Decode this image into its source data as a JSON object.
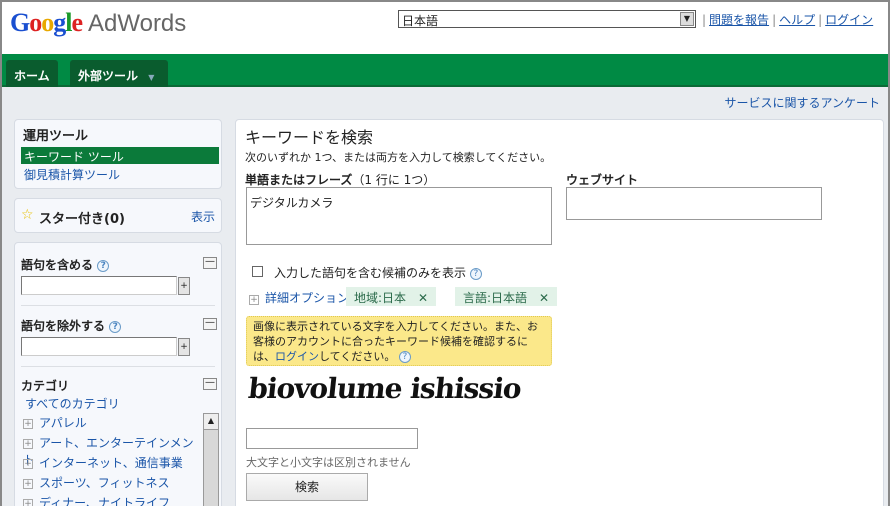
{
  "header": {
    "logo": "Google AdWords",
    "logo_google": "Google",
    "logo_product": "AdWords",
    "language": "日本語",
    "links": [
      "問題を報告",
      "ヘルプ",
      "ログイン"
    ]
  },
  "nav": {
    "tabs": [
      "ホーム",
      "外部ツール"
    ]
  },
  "survey_link": "サービスに関するアンケート",
  "sidebar": {
    "tools_title": "運用ツール",
    "tools": [
      "キーワード ツール",
      "御見積計算ツール"
    ],
    "starred": "スター付き(0)",
    "starred_show": "表示",
    "include_label": "語句を含める",
    "exclude_label": "語句を除外する",
    "category_label": "カテゴリ",
    "all_categories": "すべてのカテゴリ",
    "categories": [
      "アパレル",
      "アート、エンターテインメント",
      "インターネット、通信事業",
      "スポーツ、フィットネス",
      "ディナー、ナイトライフ"
    ]
  },
  "main": {
    "title": "キーワードを検索",
    "subtitle": "次のいずれか 1つ、または両方を入力して検索してください。",
    "words_label": "単語またはフレーズ",
    "words_hint": "（1 行に 1つ）",
    "words_value": "デジタルカメラ",
    "website_label": "ウェブサイト",
    "website_value": "",
    "checkbox_label": "入力した語句を含む候補のみを表示",
    "advanced": "詳細オプション",
    "chips": [
      "地域:日本",
      "言語:日本語"
    ],
    "notice_pre": "画像に表示されている文字を入力してください。また、お客様のアカウントに合ったキーワード候補を確認するには、",
    "notice_link": "ログイン",
    "notice_post": "してください。",
    "captcha_text": "biovolume ishissio",
    "captcha_value": "",
    "case_note": "大文字と小文字は区別されません",
    "search_button": "検索"
  }
}
